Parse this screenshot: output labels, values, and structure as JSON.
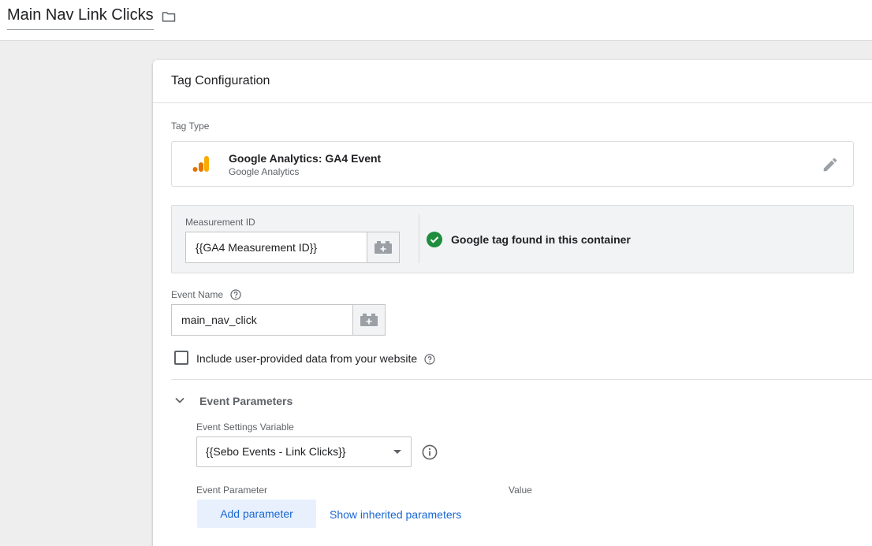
{
  "header": {
    "tag_name": "Main Nav Link Clicks",
    "folder_icon": "folder-icon"
  },
  "card": {
    "title": "Tag Configuration",
    "tag_type": {
      "label": "Tag Type",
      "name": "Google Analytics: GA4 Event",
      "provider": "Google Analytics",
      "icon": "google-analytics-icon",
      "edit_icon": "pencil-icon"
    },
    "measurement": {
      "label": "Measurement ID",
      "value": "{{GA4 Measurement ID}}",
      "status_text": "Google tag found in this container",
      "status_icon": "check-circle-icon"
    },
    "event_name": {
      "label": "Event Name",
      "value": "main_nav_click"
    },
    "user_data": {
      "label": "Include user-provided data from your website",
      "checked": false
    },
    "event_parameters": {
      "title": "Event Parameters",
      "settings_variable_label": "Event Settings Variable",
      "settings_variable_value": "{{Sebo Events - Link Clicks}}",
      "param_col_label": "Event Parameter",
      "value_col_label": "Value",
      "add_button": "Add parameter",
      "show_inherited": "Show inherited parameters"
    }
  },
  "colors": {
    "accent": "#1967d2",
    "success": "#1e8e3e",
    "ga_orange": "#f9ab00",
    "ga_dark_orange": "#e37400"
  }
}
